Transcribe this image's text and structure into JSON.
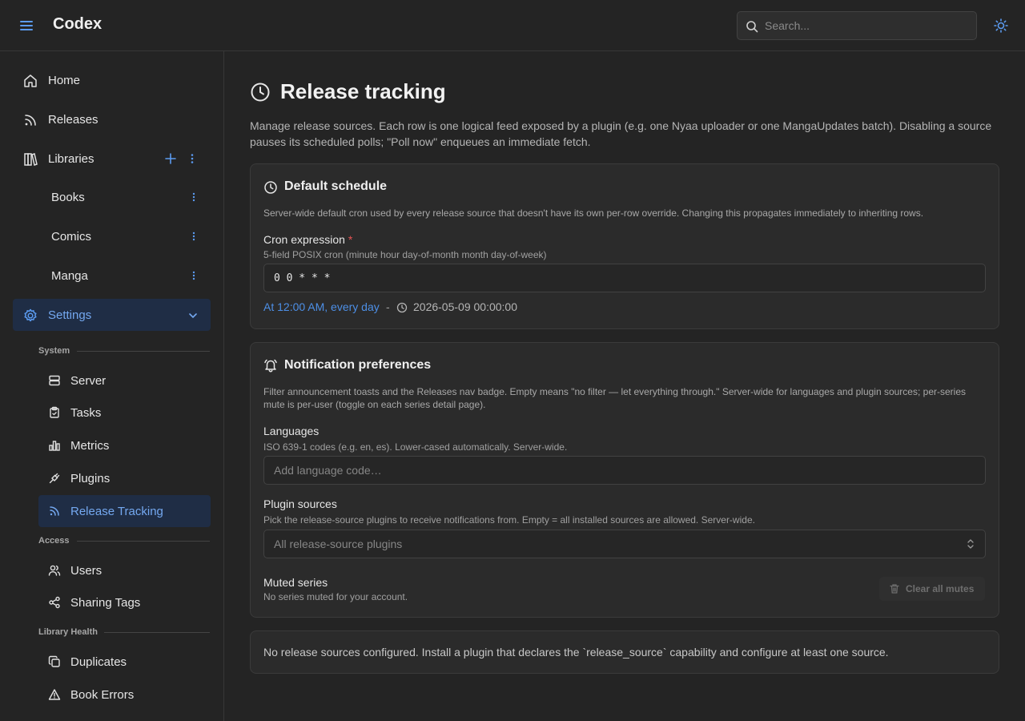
{
  "header": {
    "app_title": "Codex",
    "search_placeholder": "Search..."
  },
  "sidebar": {
    "home": "Home",
    "releases": "Releases",
    "libraries": "Libraries",
    "library_items": [
      "Books",
      "Comics",
      "Manga"
    ],
    "settings": "Settings",
    "groups": {
      "system": "System",
      "access": "Access",
      "library_health": "Library Health"
    },
    "system_items": [
      "Server",
      "Tasks",
      "Metrics",
      "Plugins",
      "Release Tracking"
    ],
    "access_items": [
      "Users",
      "Sharing Tags"
    ],
    "health_items": [
      "Duplicates",
      "Book Errors"
    ]
  },
  "page": {
    "title": "Release tracking",
    "description": "Manage release sources. Each row is one logical feed exposed by a plugin (e.g. one Nyaa uploader or one MangaUpdates batch). Disabling a source pauses its scheduled polls; \"Poll now\" enqueues an immediate fetch."
  },
  "default_schedule": {
    "title": "Default schedule",
    "description": "Server-wide default cron used by every release source that doesn't have its own per-row override. Changing this propagates immediately to inheriting rows.",
    "cron_label": "Cron expression",
    "required_mark": "*",
    "cron_help": "5-field POSIX cron (minute hour day-of-month month day-of-week)",
    "cron_value": "0 0 * * *",
    "human_readable": "At 12:00 AM, every day",
    "separator": "-",
    "next_run": "2026-05-09 00:00:00"
  },
  "notifications": {
    "title": "Notification preferences",
    "description": "Filter announcement toasts and the Releases nav badge. Empty means \"no filter — let everything through.\" Server-wide for languages and plugin sources; per-series mute is per-user (toggle on each series detail page).",
    "languages_label": "Languages",
    "languages_help": "ISO 639-1 codes (e.g. en, es). Lower-cased automatically. Server-wide.",
    "languages_placeholder": "Add language code…",
    "plugins_label": "Plugin sources",
    "plugins_help": "Pick the release-source plugins to receive notifications from. Empty = all installed sources are allowed. Server-wide.",
    "plugins_placeholder": "All release-source plugins",
    "muted_label": "Muted series",
    "muted_help": "No series muted for your account.",
    "clear_mutes": "Clear all mutes"
  },
  "sources": {
    "empty_message": "No release sources configured. Install a plugin that declares the `release_source` capability and configure at least one source."
  },
  "colors": {
    "accent": "#4d8fe6",
    "active_bg": "#1f2d45",
    "background": "#242424",
    "card_bg": "#2b2b2b"
  }
}
